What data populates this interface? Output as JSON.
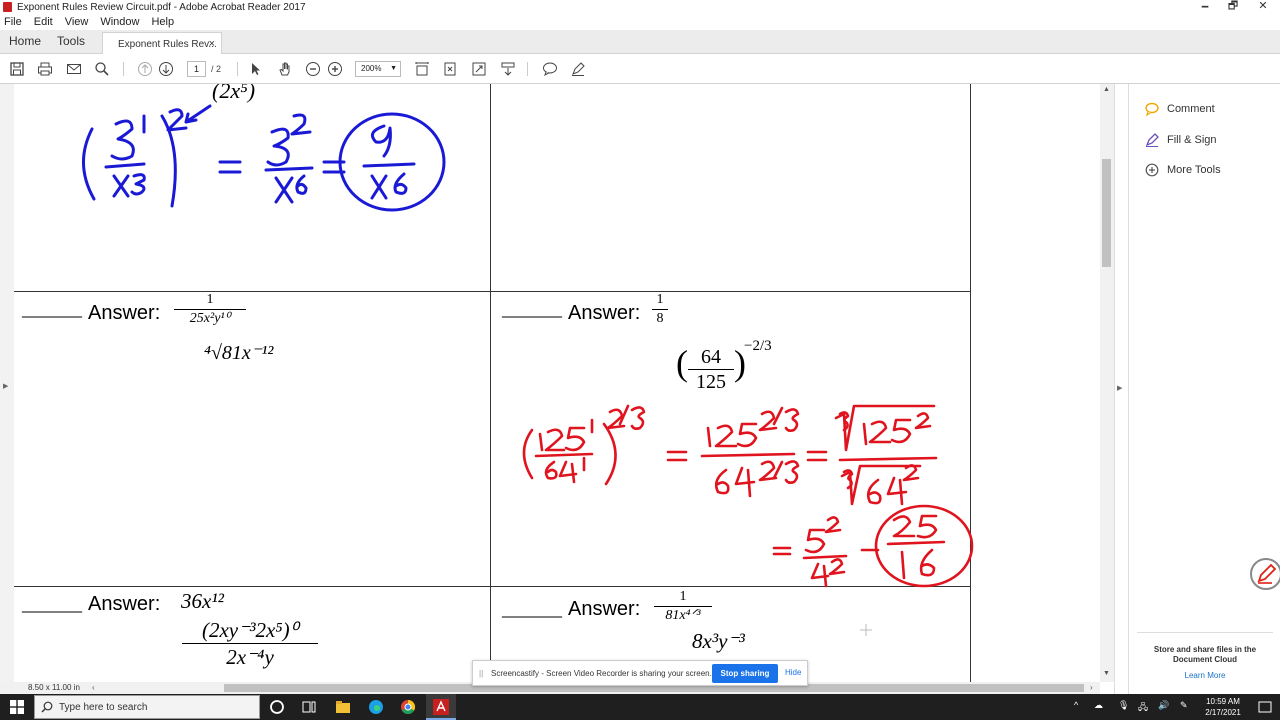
{
  "window": {
    "title": "Exponent Rules Review Circuit.pdf - Adobe Acrobat Reader 2017",
    "minimize": "🗕",
    "maximize": "🗗",
    "close": "✕"
  },
  "menu": [
    "File",
    "Edit",
    "View",
    "Window",
    "Help"
  ],
  "tabs": {
    "home": "Home",
    "tools": "Tools",
    "doc": "Exponent Rules Rev...",
    "close": "×"
  },
  "toolbar": {
    "page_current": "1",
    "page_total": "/ 2",
    "zoom": "200%"
  },
  "document": {
    "top_left_partial": "(2x⁵)",
    "cell_b": {
      "blank": "______",
      "answer_label": "Answer:",
      "answer_num": "1",
      "answer_den": "25x²y¹⁰",
      "problem": "⁴√81x⁻¹²"
    },
    "cell_c": {
      "blank": "______",
      "answer_label": "Answer:",
      "answer_num": "1",
      "answer_den": "8",
      "problem_num": "64",
      "problem_den": "125",
      "problem_exp": "−2/3"
    },
    "cell_d": {
      "blank": "______",
      "answer_label": "Answer:",
      "answer": "36x¹²",
      "problem_num": "(2xy⁻³2x⁵)⁰",
      "problem_den": "2x⁻⁴y"
    },
    "cell_e": {
      "blank": "______",
      "answer_label": "Answer:",
      "answer_num": "1",
      "answer_den": "81x⁴ᐟ³",
      "problem": "8x³y⁻³"
    }
  },
  "right_pane": {
    "comment": "Comment",
    "fill_sign": "Fill & Sign",
    "more_tools": "More Tools",
    "store_text": "Store and share files in the Document Cloud",
    "learn_more": "Learn More"
  },
  "status": {
    "page_size": "8.50 x 11.00 in"
  },
  "share_bar": {
    "grip": "||",
    "text": "Screencastify - Screen Video Recorder is sharing your screen.",
    "stop": "Stop sharing",
    "hide": "Hide"
  },
  "taskbar": {
    "search_placeholder": "Type here to search",
    "time": "10:59 AM",
    "date": "2/17/2021"
  },
  "colors": {
    "ink_blue": "#1a1ad6",
    "ink_red": "#e0141e",
    "accent": "#1a73e8"
  }
}
